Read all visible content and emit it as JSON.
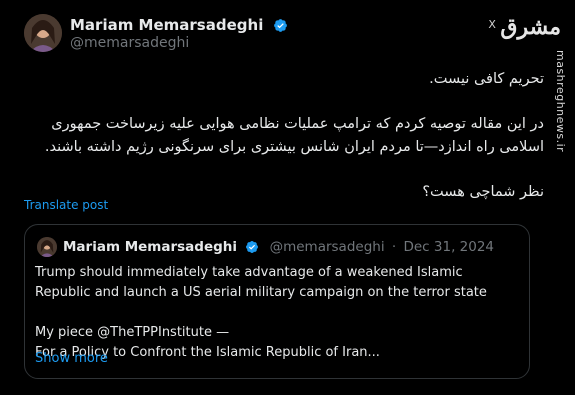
{
  "author": {
    "name": "Mariam Memarsadeghi",
    "handle": "@memarsadeghi"
  },
  "watermark": {
    "logo": "مشرق",
    "x": "X",
    "url": "mashreghnews.ir"
  },
  "post": {
    "paragraphs": [
      "تحریم کافی نیست.",
      "در این مقاله توصیه کردم که ترامپ عملیات نظامی هوایی علیه زیرساخت جمهوری اسلامی راه اندازد—تا مردم ایران شانس بیشتری برای سرنگونی رژیم داشته باشند.",
      "نظر شماچی هست؟"
    ],
    "translate_label": "Translate post"
  },
  "quote": {
    "name": "Mariam Memarsadeghi",
    "handle": "@memarsadeghi",
    "separator": "·",
    "date": "Dec 31, 2024",
    "paragraph1": "Trump should immediately take advantage of a weakened Islamic Republic and launch a US aerial military campaign on the terror state",
    "line_a": "My piece @TheTPPInstitute —",
    "line_b": "For a Policy to Confront the Islamic Republic of Iran...",
    "show_more": "Show more"
  },
  "colors": {
    "background": "#000000",
    "text": "#e7e9ea",
    "secondary": "#71767b",
    "link": "#1d9bf0",
    "verified": "#1d9bf0",
    "border": "#2f3336"
  },
  "icons": {
    "verified": "verified-badge-icon"
  }
}
